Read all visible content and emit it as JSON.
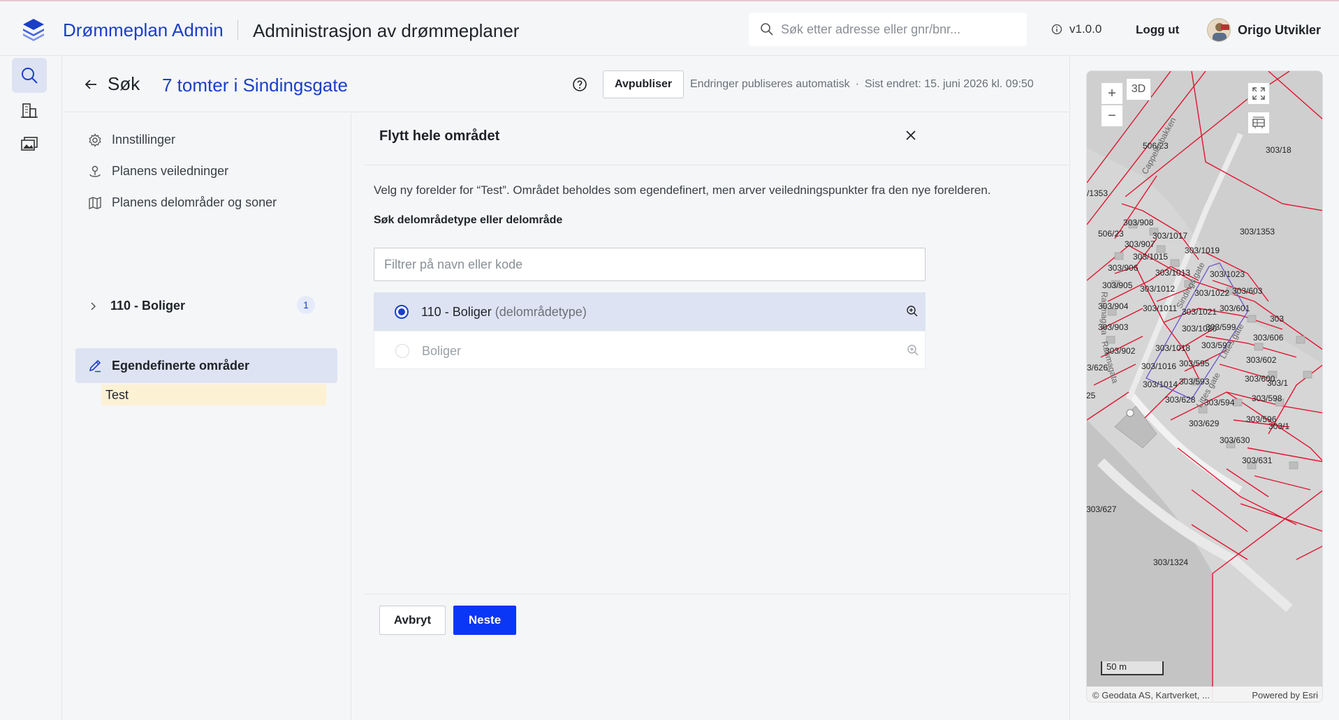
{
  "header": {
    "brand": "Drømmeplan Admin",
    "title": "Administrasjon av drømmeplaner",
    "search_placeholder": "Søk etter adresse eller gnr/bnr...",
    "version": "v1.0.0",
    "logout": "Logg ut",
    "user_name": "Origo Utvikler"
  },
  "rail": {
    "icons": [
      "search-icon",
      "buildings-icon",
      "images-icon"
    ],
    "active_index": 0
  },
  "page": {
    "back_label": "Søk",
    "title": "7 tomter i Sindingsgate",
    "unpublish_label": "Avpubliser",
    "autopublish": "Endringer publiseres automatisk",
    "last_changed": "Sist endret: 15. juni 2026 kl. 09:50"
  },
  "leftnav": {
    "items": [
      {
        "label": "Innstillinger",
        "icon": "gear-icon"
      },
      {
        "label": "Planens veiledninger",
        "icon": "pin-icon"
      },
      {
        "label": "Planens delområder og soner",
        "icon": "map-icon"
      }
    ],
    "tree_item": {
      "label": "110 - Boliger",
      "count": "1"
    },
    "active_item": "Egendefinerte områder",
    "sub_item": "Test"
  },
  "panel": {
    "title": "Flytt hele området",
    "description": "Velg ny forelder for “Test”. Området beholdes som egendefinert, men arver veiledningspunkter fra den nye forelderen.",
    "field_label": "Søk delområdetype eller delområde",
    "filter_placeholder": "Filtrer på navn eller kode",
    "options": [
      {
        "label": "110 - Boliger",
        "suffix": "(delområdetype)",
        "selected": true
      },
      {
        "label": "Boliger",
        "suffix": "",
        "selected": false
      }
    ],
    "cancel_label": "Avbryt",
    "next_label": "Neste"
  },
  "map": {
    "btn_3d": "3D",
    "zoom_in": "+",
    "zoom_out": "−",
    "scale": "50 m",
    "attribution": "Geodata AS, Kartverket, ...",
    "powered": "Powered by Esri",
    "plot_labels": [
      "506/23",
      "303/18",
      "/1353",
      "303/908",
      "303/1017",
      "506/23",
      "303/907",
      "303/1353",
      "303/1019",
      "303/1015",
      "303/906",
      "303/1023",
      "303/1013",
      "303/905",
      "303/1012",
      "303/603",
      "303/1022",
      "303/904",
      "303/1011",
      "303/601",
      "303/1021",
      "303/903",
      "303/599",
      "303/1020",
      "303/606",
      "303/597",
      "303/902",
      "303/1018",
      "303/602",
      "303/595",
      "3/626",
      "303/1016",
      "303/600",
      "303/593",
      "303/1014",
      "303/628",
      "303/598",
      "303/594",
      "303/596",
      "303/629",
      "303/630",
      "303/631",
      "303/627",
      "303/1324",
      "303",
      "303/1",
      "303/1",
      "25"
    ],
    "street_labels": [
      "Cappelenbakken",
      "Sindings gate",
      "Littes gate",
      "Littes gate",
      "Raumagata",
      "Raumagata"
    ],
    "accent_color": "#e0142f"
  },
  "colors": {
    "brand": "#1a3fc7",
    "primary_button": "#0a36f5",
    "selected_row": "#dde3f2",
    "sub_item_bg": "#fdf1d4"
  }
}
